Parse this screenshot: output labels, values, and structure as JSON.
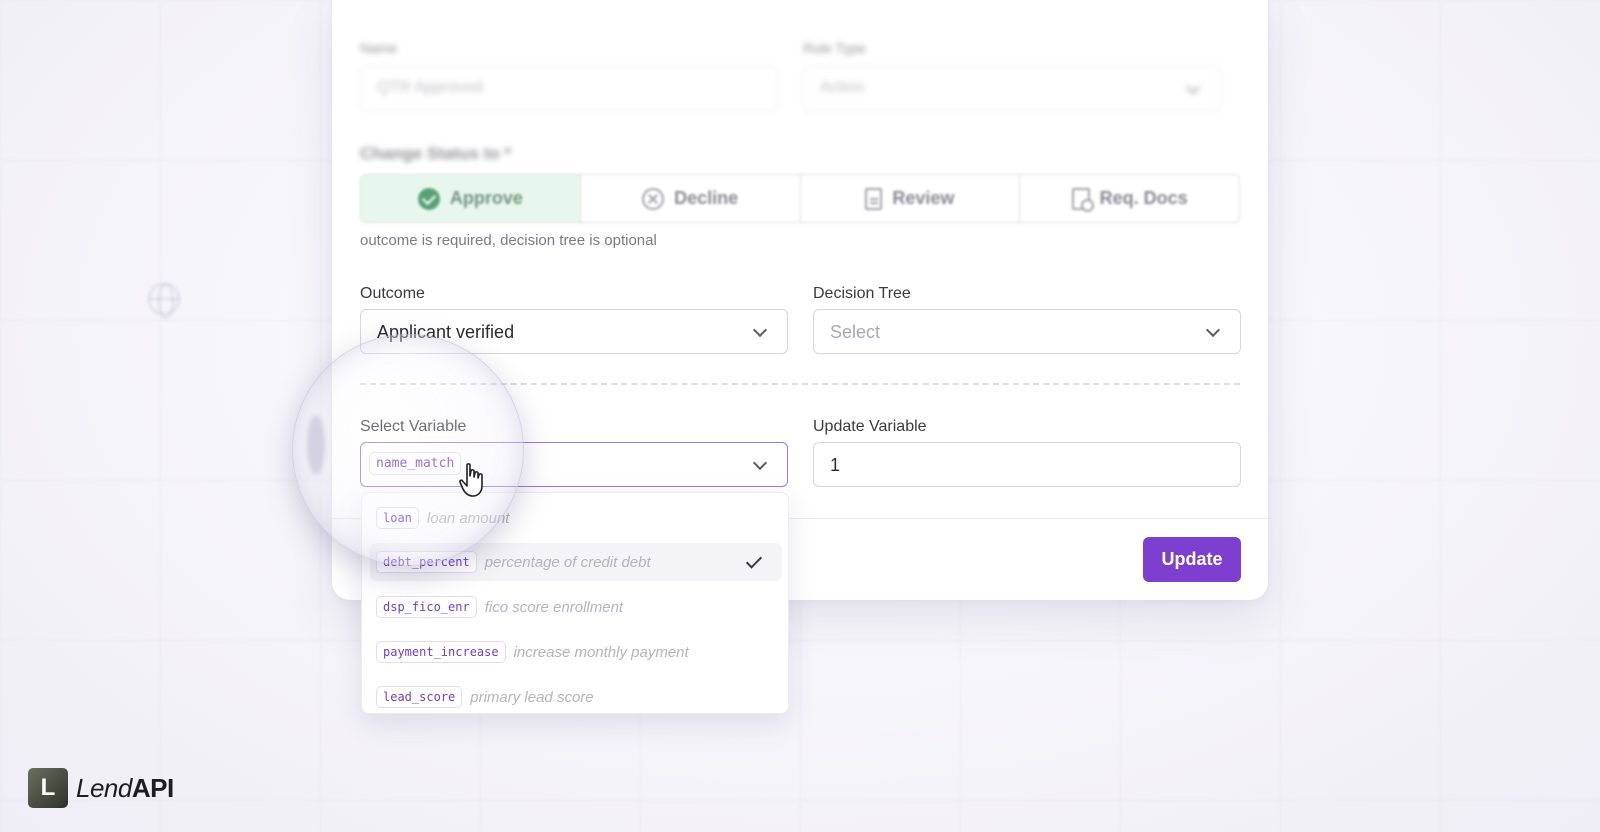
{
  "form": {
    "name_label": "Name",
    "name_value": "QTR Approved",
    "rule_type_label": "Rule Type",
    "rule_type_value": "Action",
    "change_status_label": "Change Status to *",
    "status_options": [
      {
        "label": "Approve",
        "icon": "check-circle-icon",
        "active": true
      },
      {
        "label": "Decline",
        "icon": "x-circle-icon",
        "active": false
      },
      {
        "label": "Review",
        "icon": "document-icon",
        "active": false
      },
      {
        "label": "Req. Docs",
        "icon": "documents-request-icon",
        "active": false
      }
    ],
    "helper_text": "outcome is required, decision tree is optional",
    "outcome_label": "Outcome",
    "outcome_value": "Applicant verified",
    "decision_tree_label": "Decision Tree",
    "decision_tree_placeholder": "Select",
    "select_variable_label": "Select Variable",
    "selected_variable": "name_match",
    "update_variable_label": "Update Variable",
    "update_variable_value": "1",
    "update_button": "Update"
  },
  "variable_dropdown": {
    "options": [
      {
        "key": "loan",
        "description": "loan amount",
        "selected": false
      },
      {
        "key": "debt_percent",
        "description": "percentage of credit debt",
        "selected": true
      },
      {
        "key": "dsp_fico_enr",
        "description": "fico score enrollment",
        "selected": false
      },
      {
        "key": "payment_increase",
        "description": "increase monthly payment",
        "selected": false
      },
      {
        "key": "lead_score",
        "description": "primary lead score",
        "selected": false
      }
    ]
  },
  "brand": {
    "logo_letter": "L",
    "name_part1": "Lend",
    "name_part2": "API",
    "accent_color": "#7c3fd0",
    "approve_color": "#2f8a55"
  }
}
